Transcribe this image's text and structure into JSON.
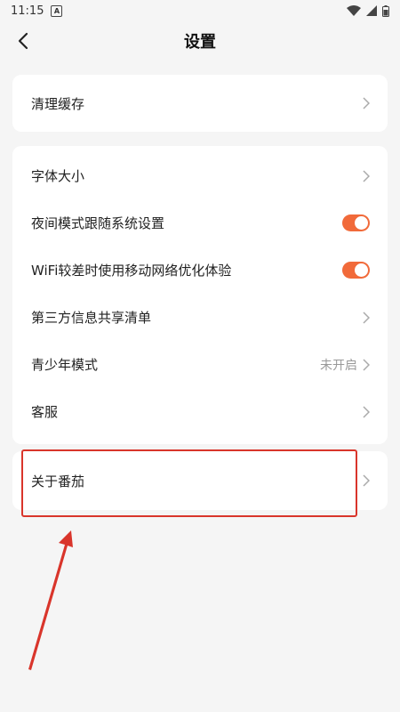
{
  "status_bar": {
    "time": "11:15",
    "badge": "A"
  },
  "header": {
    "title": "设置",
    "back_icon": "chevron-left-icon"
  },
  "sections": [
    {
      "items": [
        {
          "label": "清理缓存",
          "type": "link"
        }
      ]
    },
    {
      "items": [
        {
          "label": "字体大小",
          "type": "link"
        },
        {
          "label": "夜间模式跟随系统设置",
          "type": "toggle",
          "on": true
        },
        {
          "label": "WiFi较差时使用移动网络优化体验",
          "type": "toggle",
          "on": true
        },
        {
          "label": "第三方信息共享清单",
          "type": "link"
        },
        {
          "label": "青少年模式",
          "type": "link",
          "value": "未开启"
        },
        {
          "label": "客服",
          "type": "link"
        }
      ]
    },
    {
      "items": [
        {
          "label": "关于番茄",
          "type": "link"
        }
      ]
    }
  ],
  "colors": {
    "accent": "#f16a3a",
    "annotation": "#d9352b"
  }
}
